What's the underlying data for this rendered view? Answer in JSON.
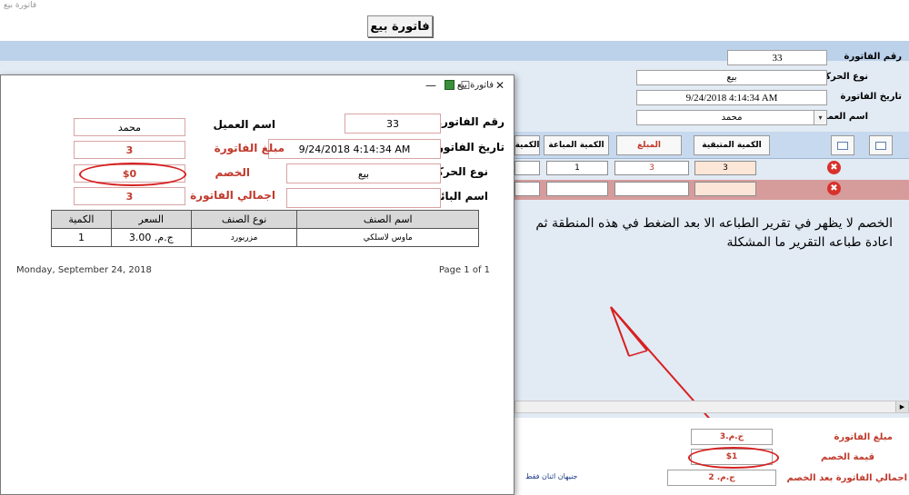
{
  "window_title": "فاتورة بيع",
  "main_title": "فاتورة بيع",
  "header_form": {
    "invoice_no_label": "رقم الفاتورة",
    "invoice_no": "33",
    "move_type_label": "نوع الحركة",
    "move_type": "بيع",
    "invoice_date_label": "تاريخ الفاتورة",
    "invoice_date": "9/24/2018 4:14:34 AM",
    "customer_label": "اسم العميل",
    "customer": "محمد"
  },
  "grid": {
    "columns": [
      "الكمية المتبقية",
      "المبلغ",
      "الكمية المباعة",
      "الكمية"
    ],
    "row1": {
      "remaining": "3",
      "amount": "3",
      "sold": "1"
    }
  },
  "note": "الخصم لا يظهر في تقرير الطباعه الا بعد الضغط في هذه المنطقة ثم اعادة طباعه التقرير ما المشكلة",
  "bottom": {
    "invoice_amount_label": "مبلغ الفاتورة",
    "invoice_amount": "ج.م.3",
    "discount_label": "قيمة الخصم",
    "discount": "$1",
    "total_after_label": "اجمالي الفاتورة بعد الخصم",
    "total_after": "ج.م. 2",
    "total_words": "جنيهان اثنان فقط"
  },
  "report": {
    "title": "فاتورة بيع",
    "invoice_no_label": "رقم الفاتورة",
    "invoice_no": "33",
    "customer_label": "اسم العميل",
    "customer": "محمد",
    "invoice_date_label": "تاريخ الفاتورة",
    "invoice_date": "9/24/2018 4:14:34 AM",
    "amount_label": "مبلغ الفاتورة",
    "amount": "3",
    "move_type_label": "نوع الحركة",
    "move_type": "بيع",
    "discount_label": "الخصم",
    "discount": "$0",
    "seller_label": "اسم البائع",
    "seller": "",
    "total_label": "اجمالي الفاتورة",
    "total": "3",
    "table": {
      "headers": [
        "الكمية",
        "السعر",
        "نوع الصنف",
        "اسم الصنف"
      ],
      "row": [
        "1",
        "ج.م. 3.00",
        "مزربورد",
        "ماوس لاسلكي"
      ]
    },
    "footer_date": "Monday, September 24, 2018",
    "footer_page": "Page 1 of 1"
  },
  "colors": {
    "accent_red": "#d62020",
    "band_blue": "#bcd1ea"
  }
}
